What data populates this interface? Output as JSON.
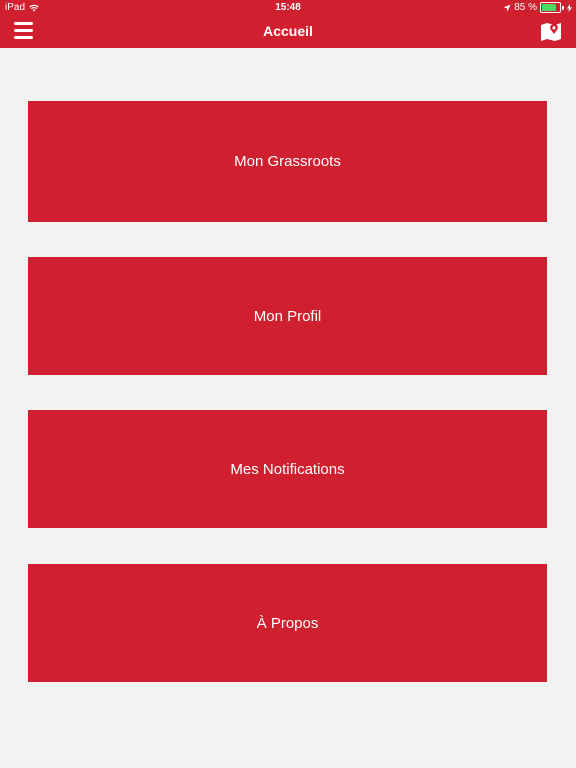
{
  "status_bar": {
    "device": "iPad",
    "time": "15:48",
    "battery": "85 %",
    "battery_level": 0.85
  },
  "header": {
    "title": "Accueil",
    "menu_icon": "hamburger-menu-icon",
    "map_icon": "map-pin-icon"
  },
  "menu": {
    "items": [
      {
        "label": "Mon Grassroots"
      },
      {
        "label": "Mon Profil"
      },
      {
        "label": "Mes Notifications"
      },
      {
        "label": "À Propos"
      }
    ]
  },
  "colors": {
    "brand": "#d0202f",
    "background": "#f2f2f2",
    "battery": "#4cd964"
  }
}
